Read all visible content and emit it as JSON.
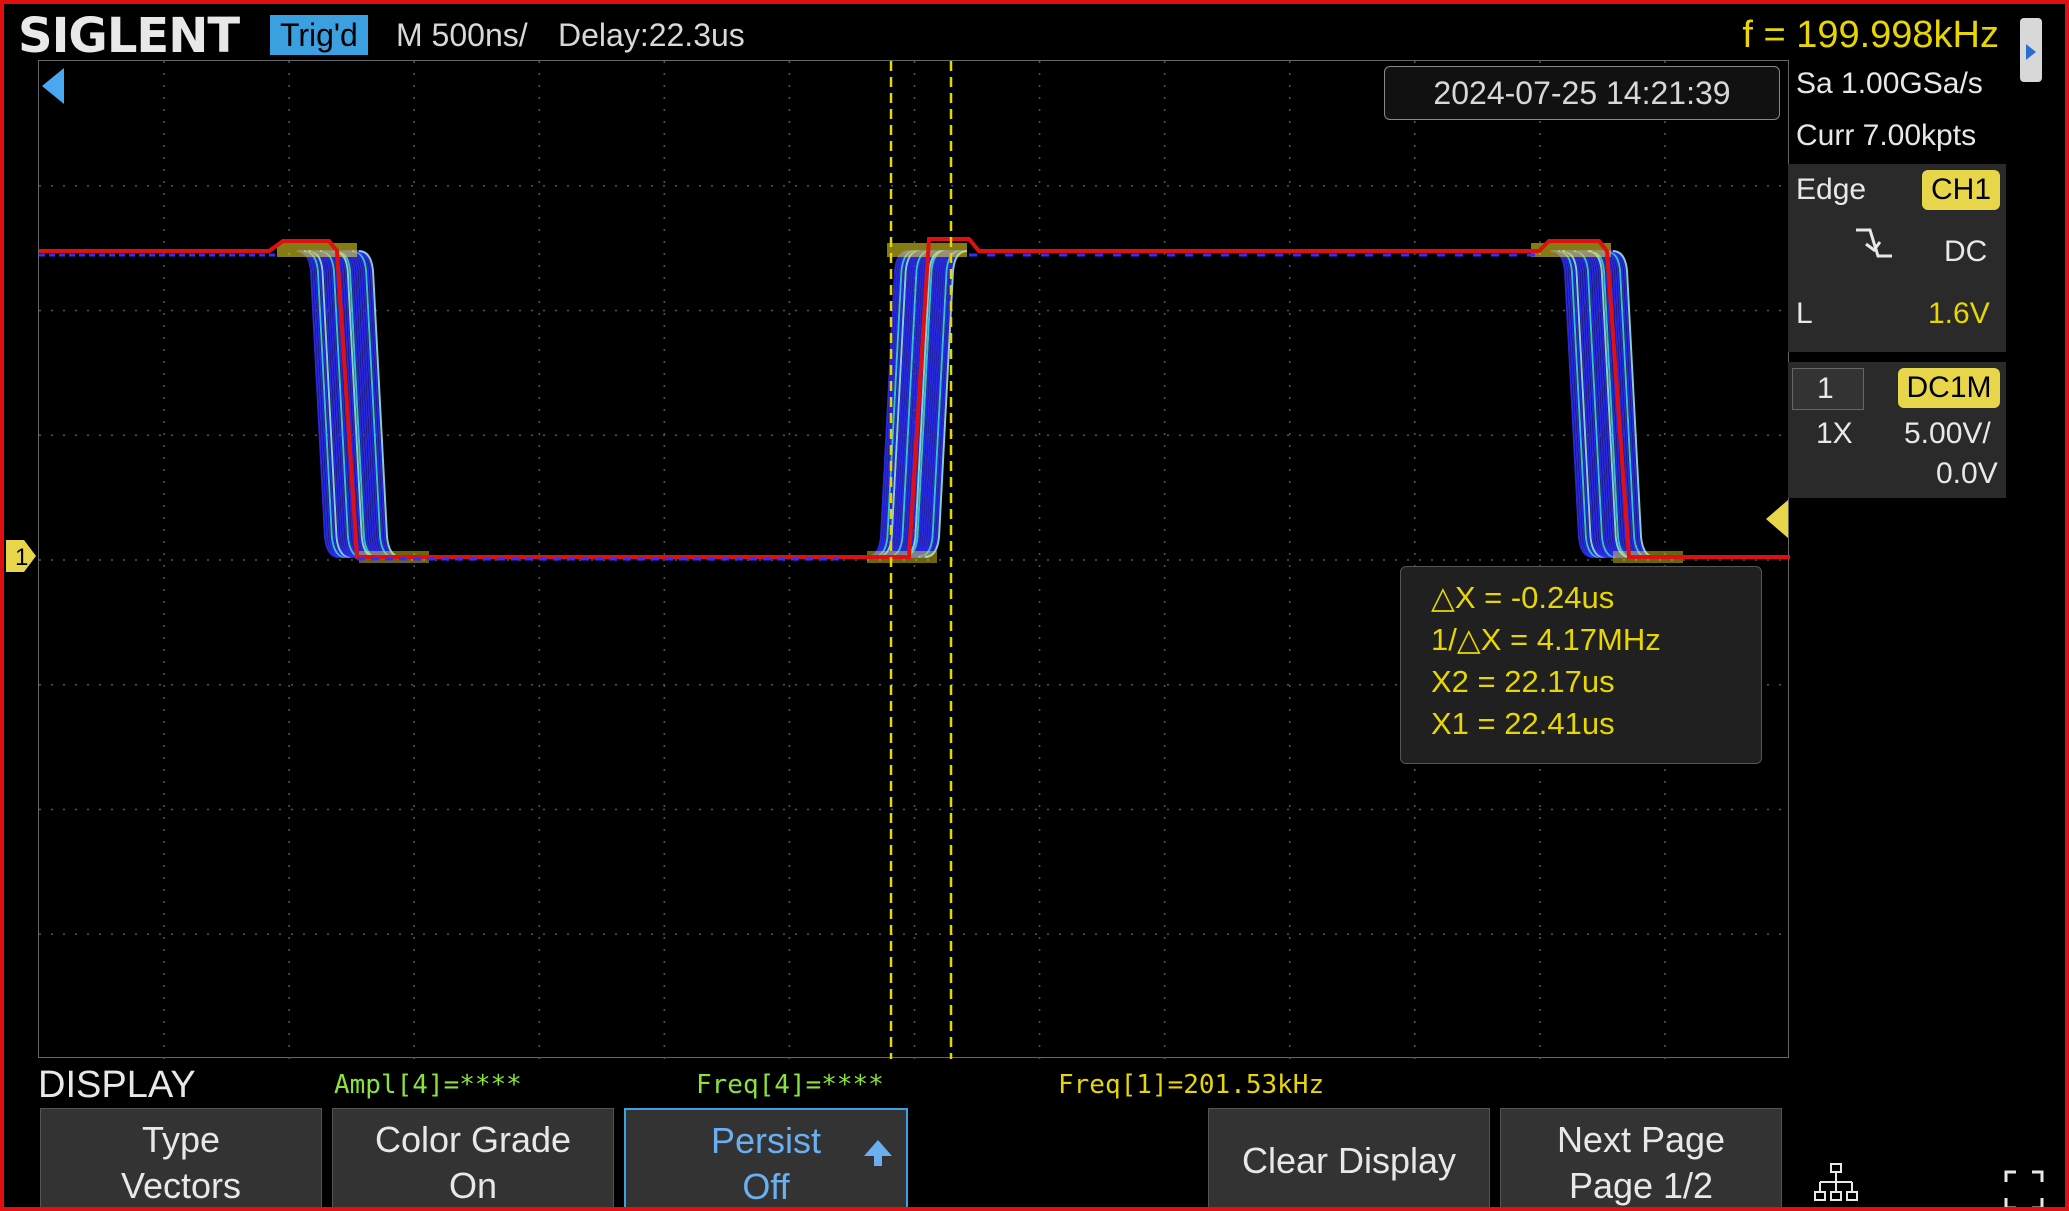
{
  "header": {
    "brand": "SIGLENT",
    "trigger_status": "Trig'd",
    "timebase": "M 500ns/",
    "delay": "Delay:22.3us",
    "frequency": "f = 199.998kHz"
  },
  "screen": {
    "timestamp": "2024-07-25 14:21:39",
    "cursor_readout": {
      "delta_x": "△X = -0.24us",
      "inv_delta_x": "1/△X = 4.17MHz",
      "x2": "X2 = 22.17us",
      "x1": "X1 = 22.41us"
    },
    "ch1_ground_label": "1",
    "trace_colors": {
      "main": "#e01010",
      "persist_hi": "#3030ff",
      "persist_mid": "#40e0f0",
      "persist_warm": "#f0e020",
      "cursor": "#e8d600"
    }
  },
  "right_panel": {
    "sample_rate": "Sa 1.00GSa/s",
    "memory": "Curr 7.00kpts",
    "trigger": {
      "type": "Edge",
      "source": "CH1",
      "coupling": "DC",
      "level_label": "L",
      "level_value": "1.6V",
      "slope_icon": "falling-edge-icon"
    },
    "channel": {
      "number": "1",
      "coupling": "DC1M",
      "probe": "1X",
      "scale": "5.00V/",
      "offset": "0.0V"
    }
  },
  "bottom": {
    "menu_title": "DISPLAY",
    "measurements": [
      {
        "text": "Ampl[4]=****"
      },
      {
        "text": "Freq[4]=****"
      },
      {
        "text": "Freq[1]=201.53kHz"
      }
    ],
    "softkeys": {
      "type": {
        "line1": "Type",
        "line2": "Vectors"
      },
      "color_grade": {
        "line1": "Color Grade",
        "line2": "On"
      },
      "persist": {
        "line1": "Persist",
        "line2": "Off"
      },
      "clear_display": {
        "label": "Clear Display"
      },
      "next_page": {
        "line1": "Next Page",
        "line2": "Page 1/2"
      }
    }
  }
}
